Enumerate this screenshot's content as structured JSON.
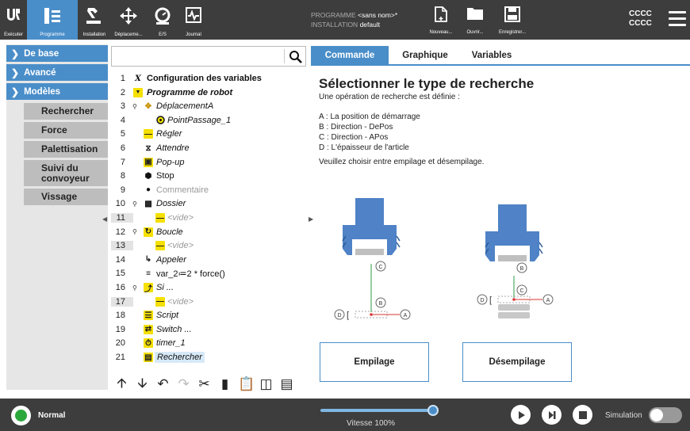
{
  "topbar": {
    "nav": [
      {
        "label": "Exécuter",
        "icon": "ur-logo-icon"
      },
      {
        "label": "Programme",
        "icon": "program-icon"
      },
      {
        "label": "Installation",
        "icon": "robot-arm-icon"
      },
      {
        "label": "Déplaceme...",
        "icon": "move-icon"
      },
      {
        "label": "E/S",
        "icon": "io-icon"
      },
      {
        "label": "Journal",
        "icon": "log-icon"
      }
    ],
    "program_label": "PROGRAMME",
    "program_value": "<sans nom>*",
    "installation_label": "INSTALLATION",
    "installation_value": "default",
    "file_buttons": [
      {
        "label": "Nouveau...",
        "icon": "new-file-icon"
      },
      {
        "label": "Ouvrir...",
        "icon": "folder-icon"
      },
      {
        "label": "Enregistrer...",
        "icon": "save-icon"
      }
    ],
    "user_line1": "CCCC",
    "user_line2": "CCCC"
  },
  "leftnav": {
    "categories": [
      "De base",
      "Avancé",
      "Modèles"
    ],
    "templates": [
      "Rechercher",
      "Force",
      "Palettisation",
      "Suivi du convoyeur",
      "Vissage"
    ]
  },
  "tree": {
    "rows": [
      {
        "num": "1",
        "text": "Configuration des variables",
        "icon": "x-variable-icon"
      },
      {
        "num": "2",
        "text": "Programme de robot",
        "icon": "program-arrow-icon"
      },
      {
        "num": "3",
        "text": "DéplacementA",
        "icon": "move-icon"
      },
      {
        "num": "4",
        "text": "PointPassage_1",
        "icon": "waypoint-icon"
      },
      {
        "num": "5",
        "text": "Régler",
        "icon": "set-icon"
      },
      {
        "num": "6",
        "text": "Attendre",
        "icon": "hourglass-icon"
      },
      {
        "num": "7",
        "text": "Pop-up",
        "icon": "popup-icon"
      },
      {
        "num": "8",
        "text": "Stop",
        "icon": "stop-icon"
      },
      {
        "num": "9",
        "text": "Commentaire",
        "icon": "comment-icon"
      },
      {
        "num": "10",
        "text": "Dossier",
        "icon": "folder-icon"
      },
      {
        "num": "11",
        "text": "<vide>",
        "icon": "empty-icon"
      },
      {
        "num": "12",
        "text": "Boucle",
        "icon": "loop-icon"
      },
      {
        "num": "13",
        "text": "<vide>",
        "icon": "empty-icon"
      },
      {
        "num": "14",
        "text": "Appeler",
        "icon": "call-icon"
      },
      {
        "num": "15",
        "text": "var_2≔2 * force()",
        "icon": "assignment-icon"
      },
      {
        "num": "16",
        "text": "Si ...",
        "icon": "if-icon"
      },
      {
        "num": "17",
        "text": "<vide>",
        "icon": "empty-icon"
      },
      {
        "num": "18",
        "text": "Script",
        "icon": "script-icon"
      },
      {
        "num": "19",
        "text": "Switch ...",
        "icon": "switch-icon"
      },
      {
        "num": "20",
        "text": "timer_1",
        "icon": "timer-icon"
      },
      {
        "num": "21",
        "text": "Rechercher",
        "icon": "search-node-icon"
      }
    ]
  },
  "tabs": [
    "Commande",
    "Graphique",
    "Variables"
  ],
  "panel": {
    "title": "Sélectionner le type de recherche",
    "intro": "Une opération de recherche est définie :",
    "items": [
      "A : La position de démarrage",
      "B : Direction - DePos",
      "C : Direction - APos",
      "D : L'épaisseur de l'article"
    ],
    "prompt": "Veuillez choisir entre empilage et désempilage.",
    "stack_button": "Empilage",
    "destack_button": "Désempilage",
    "diagram_labels": {
      "a": "A",
      "b": "B",
      "c": "C",
      "d": "D"
    }
  },
  "footer": {
    "status": "Normal",
    "speed": "Vitesse 100%",
    "speed_value": 100,
    "simulation": "Simulation"
  },
  "colors": {
    "accent": "#4a8ec9",
    "bar": "#3d3d3d",
    "status": "#2ba83b",
    "marker": "#f5e000"
  }
}
